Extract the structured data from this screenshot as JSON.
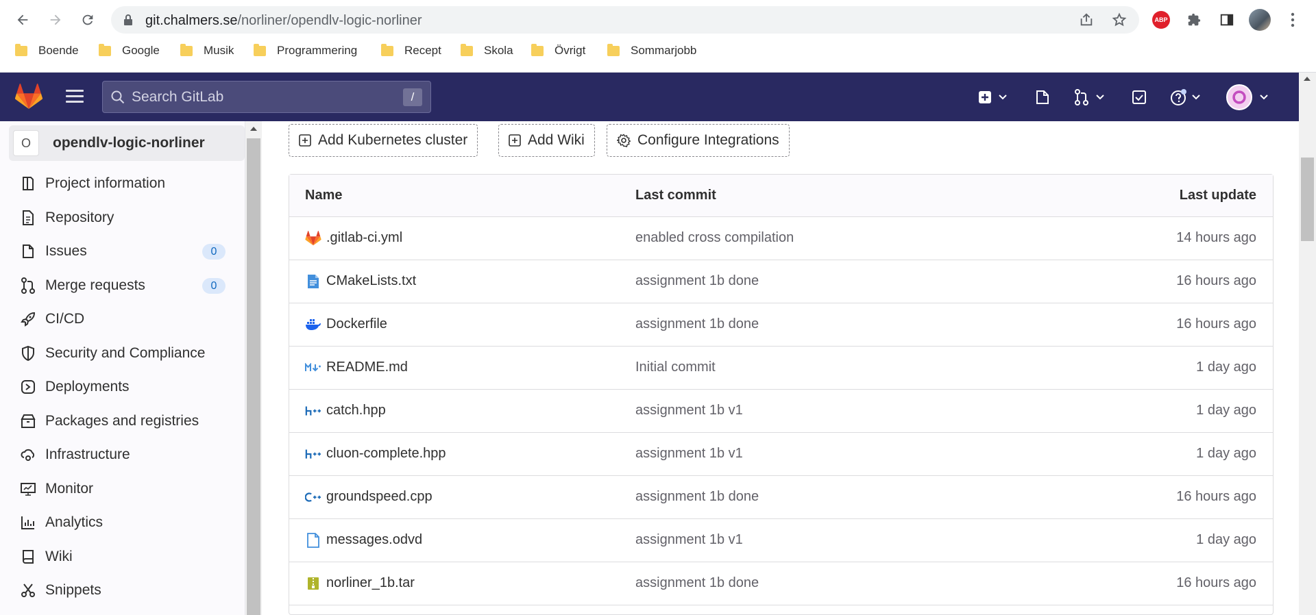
{
  "browser": {
    "url_host": "git.chalmers.se",
    "url_path": "/norliner/opendlv-logic-norliner",
    "extension_abp": "ABP",
    "bookmarks": [
      "Boende",
      "Google",
      "Musik",
      "Programmering",
      "Recept",
      "Skola",
      "Övrigt",
      "Sommarjobb"
    ]
  },
  "gitlab": {
    "search_placeholder": "Search GitLab",
    "search_shortcut": "/"
  },
  "sidebar": {
    "project_initial": "O",
    "project_name": "opendlv-logic-norliner",
    "items": [
      {
        "label": "Project information",
        "icon": "project-info-icon"
      },
      {
        "label": "Repository",
        "icon": "document-icon"
      },
      {
        "label": "Issues",
        "icon": "issues-icon",
        "badge": "0"
      },
      {
        "label": "Merge requests",
        "icon": "merge-request-icon",
        "badge": "0"
      },
      {
        "label": "CI/CD",
        "icon": "rocket-icon"
      },
      {
        "label": "Security and Compliance",
        "icon": "shield-icon"
      },
      {
        "label": "Deployments",
        "icon": "deployments-icon"
      },
      {
        "label": "Packages and registries",
        "icon": "package-icon"
      },
      {
        "label": "Infrastructure",
        "icon": "cloud-gear-icon"
      },
      {
        "label": "Monitor",
        "icon": "monitor-icon"
      },
      {
        "label": "Analytics",
        "icon": "chart-icon"
      },
      {
        "label": "Wiki",
        "icon": "book-icon"
      },
      {
        "label": "Snippets",
        "icon": "scissors-icon"
      }
    ]
  },
  "actions": {
    "add_kubernetes": "Add Kubernetes cluster",
    "add_wiki": "Add Wiki",
    "configure_integrations": "Configure Integrations"
  },
  "table": {
    "headers": {
      "name": "Name",
      "commit": "Last commit",
      "update": "Last update"
    },
    "rows": [
      {
        "name": ".gitlab-ci.yml",
        "commit": "enabled cross compilation",
        "update": "14 hours ago",
        "icon": "gitlab-icon"
      },
      {
        "name": "CMakeLists.txt",
        "commit": "assignment 1b done",
        "update": "16 hours ago",
        "icon": "text-file-icon"
      },
      {
        "name": "Dockerfile",
        "commit": "assignment 1b done",
        "update": "16 hours ago",
        "icon": "docker-icon"
      },
      {
        "name": "README.md",
        "commit": "Initial commit",
        "update": "1 day ago",
        "icon": "markdown-icon"
      },
      {
        "name": "catch.hpp",
        "commit": "assignment 1b v1",
        "update": "1 day ago",
        "icon": "hpp-icon"
      },
      {
        "name": "cluon-complete.hpp",
        "commit": "assignment 1b v1",
        "update": "1 day ago",
        "icon": "hpp-icon"
      },
      {
        "name": "groundspeed.cpp",
        "commit": "assignment 1b done",
        "update": "16 hours ago",
        "icon": "cpp-icon"
      },
      {
        "name": "messages.odvd",
        "commit": "assignment 1b v1",
        "update": "1 day ago",
        "icon": "file-icon"
      },
      {
        "name": "norliner_1b.tar",
        "commit": "assignment 1b done",
        "update": "16 hours ago",
        "icon": "archive-icon"
      }
    ]
  },
  "colors": {
    "gitlab_nav": "#292961",
    "badge_bg": "#dbe8fb",
    "badge_text": "#1068bf",
    "abp_red": "#e0202b"
  }
}
